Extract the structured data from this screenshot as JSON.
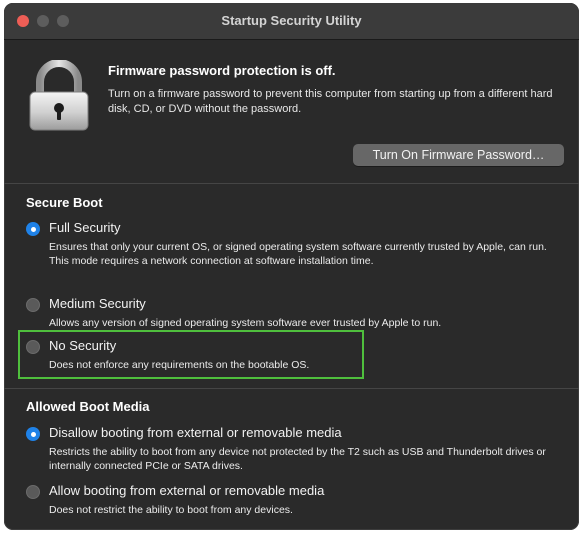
{
  "window": {
    "title": "Startup Security Utility"
  },
  "firmware": {
    "heading": "Firmware password protection is off.",
    "description": "Turn on a firmware password to prevent this computer from starting up from a different hard disk, CD, or DVD without the password.",
    "button_label": "Turn On Firmware Password…",
    "icon": "lock-icon"
  },
  "secure_boot": {
    "title": "Secure Boot",
    "options": [
      {
        "label": "Full Security",
        "description": "Ensures that only your current OS, or signed operating system software currently trusted by Apple, can run. This mode requires a network connection at software installation time.",
        "selected": true
      },
      {
        "label": "Medium Security",
        "description": "Allows any version of signed operating system software ever trusted by Apple to run.",
        "selected": false
      },
      {
        "label": "No Security",
        "description": "Does not enforce any requirements on the bootable OS.",
        "selected": false
      }
    ]
  },
  "boot_media": {
    "title": "Allowed Boot Media",
    "options": [
      {
        "label": "Disallow booting from external or removable media",
        "description": "Restricts the ability to boot from any device not protected by the T2 such as USB and Thunderbolt drives or internally connected PCIe or SATA drives.",
        "selected": true
      },
      {
        "label": "Allow booting from external or removable media",
        "description": "Does not restrict the ability to boot from any devices.",
        "selected": false
      }
    ]
  },
  "colors": {
    "accent": "#1f82e8",
    "highlight": "#4fbf3d",
    "close_button": "#ee5e56",
    "window_bg": "#2a2a2a"
  }
}
